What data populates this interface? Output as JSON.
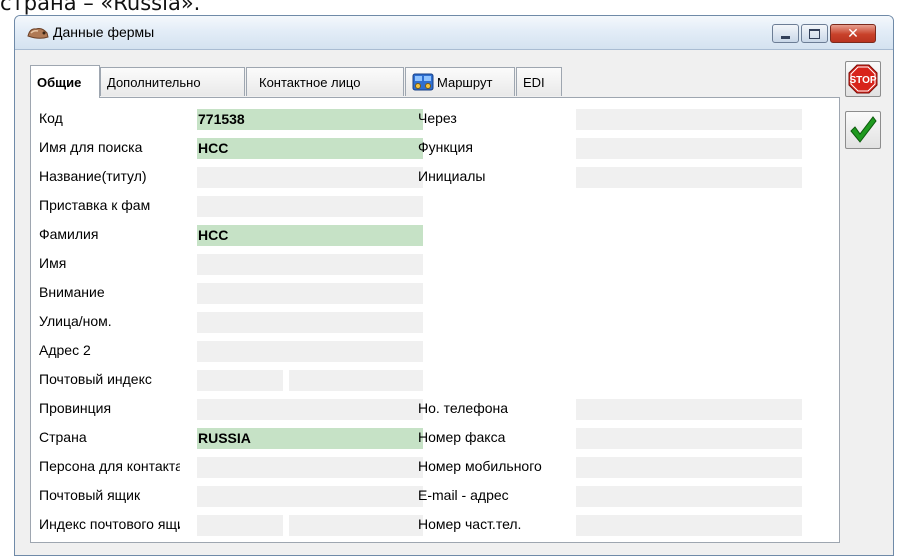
{
  "top_fragment": "страна – «Russia».",
  "window": {
    "title": "Данные фермы",
    "close_glyph": "✕"
  },
  "tabs": [
    {
      "label": "Общие",
      "active": true
    },
    {
      "label": "Дополнительно",
      "active": false
    },
    {
      "label": "Контактное лицо",
      "active": false
    },
    {
      "label": "Маршрут",
      "active": false,
      "icon": "route-icon"
    },
    {
      "label": "EDI",
      "active": false
    }
  ],
  "left_fields": [
    {
      "label": "Код",
      "value": "771538",
      "filled": true
    },
    {
      "label": "Имя для поиска",
      "value": "HCC",
      "filled": true
    },
    {
      "label": "Название(титул)",
      "value": "",
      "filled": false
    },
    {
      "label": "Приставка к фам",
      "value": "",
      "filled": false
    },
    {
      "label": "Фамилия",
      "value": "HCC",
      "filled": true
    },
    {
      "label": "Имя",
      "value": "",
      "filled": false
    },
    {
      "label": "Внимание",
      "value": "",
      "filled": false
    },
    {
      "label": "Улица/ном.",
      "value": "",
      "filled": false
    },
    {
      "label": "Адрес 2",
      "value": "",
      "filled": false
    },
    {
      "label": "Почтовый индекс",
      "value": "",
      "value2": "",
      "split": true
    },
    {
      "label": "Провинция",
      "value": "",
      "filled": false
    },
    {
      "label": "Страна",
      "value": "RUSSIA",
      "filled": true
    },
    {
      "label": "Персона для контакта",
      "value": "",
      "filled": false
    },
    {
      "label": "Почтовый ящик",
      "value": "",
      "filled": false
    },
    {
      "label": "Индекс почтового ящика",
      "value": "",
      "value2": "",
      "split": true
    }
  ],
  "right_fields_top": [
    {
      "label": "Через",
      "value": ""
    },
    {
      "label": "Функция",
      "value": ""
    },
    {
      "label": "Инициалы",
      "value": ""
    }
  ],
  "right_fields_bottom": [
    {
      "label": "Но. телефона",
      "value": ""
    },
    {
      "label": "Номер факса",
      "value": ""
    },
    {
      "label": "Номер мобильного",
      "value": ""
    },
    {
      "label": "E-mail - адрес",
      "value": ""
    },
    {
      "label": "Номер част.тел.",
      "value": ""
    }
  ],
  "side_buttons": {
    "stop_label": "STOP",
    "stop_icon": "stop-sign-icon",
    "ok_icon": "checkmark-icon"
  },
  "colors": {
    "filled_field": "#c6e2c6",
    "empty_field": "#f0f0f0",
    "stop_red": "#d8231a",
    "check_green": "#1f9a1f"
  }
}
